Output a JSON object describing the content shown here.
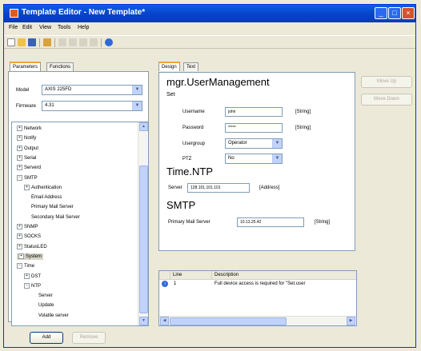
{
  "window": {
    "title": "Template Editor - New Template*"
  },
  "menu": [
    "File",
    "Edit",
    "View",
    "Tools",
    "Help"
  ],
  "left": {
    "tabs": [
      "Parameters",
      "Functions"
    ],
    "model_label": "Model",
    "model_value": "AXIS 225FD",
    "firmware_label": "Firmware",
    "firmware_value": "4.31",
    "tree": [
      {
        "label": "Network",
        "indent": 0,
        "expander": "+"
      },
      {
        "label": "Notify",
        "indent": 0,
        "expander": "+"
      },
      {
        "label": "Output",
        "indent": 0,
        "expander": "+"
      },
      {
        "label": "Serial",
        "indent": 0,
        "expander": "+"
      },
      {
        "label": "Serverd",
        "indent": 0,
        "expander": "+"
      },
      {
        "label": "SMTP",
        "indent": 0,
        "expander": "−"
      },
      {
        "label": "Authentication",
        "indent": 1,
        "expander": "+"
      },
      {
        "label": "Email Address",
        "indent": 2,
        "expander": ""
      },
      {
        "label": "Primary Mail Server",
        "indent": 2,
        "expander": ""
      },
      {
        "label": "Secondary Mail Server",
        "indent": 2,
        "expander": ""
      },
      {
        "label": "SNMP",
        "indent": 0,
        "expander": "+"
      },
      {
        "label": "SOCKS",
        "indent": 0,
        "expander": "+"
      },
      {
        "label": "StatusLED",
        "indent": 0,
        "expander": "+"
      },
      {
        "label": "System",
        "indent": 0,
        "expander": "+",
        "selected": true
      },
      {
        "label": "Time",
        "indent": 0,
        "expander": "−"
      },
      {
        "label": "DST",
        "indent": 1,
        "expander": "+"
      },
      {
        "label": "NTP",
        "indent": 1,
        "expander": "−"
      },
      {
        "label": "Server",
        "indent": 3,
        "expander": ""
      },
      {
        "label": "Update",
        "indent": 3,
        "expander": ""
      },
      {
        "label": "Volatile server",
        "indent": 3,
        "expander": ""
      }
    ],
    "add_button": "Add",
    "remove_button": "Remove"
  },
  "right": {
    "tabs": [
      "Design",
      "Text"
    ],
    "move_up": "Move Up",
    "move_down": "Move Down",
    "section1": {
      "heading": "mgr.UserManagement",
      "sub": "Set",
      "username_label": "Username",
      "username_value": "john",
      "username_type": "[String]",
      "password_label": "Password",
      "password_value": "*****",
      "password_type": "[String]",
      "usergroup_label": "Usergroup",
      "usergroup_value": "Operator",
      "ptz_label": "PTZ",
      "ptz_value": "No"
    },
    "section2": {
      "heading": "Time.NTP",
      "server_label": "Server",
      "server_value": "128.101.101.101",
      "server_type": "[Address]"
    },
    "section3": {
      "heading": "SMTP",
      "pms_label": "Primary Mail Server",
      "pms_value": "10.13.25.42",
      "pms_type": "[String]"
    },
    "grid": {
      "headers": [
        "Line",
        "Description"
      ],
      "rows": [
        {
          "line": "1",
          "description": "Full device access is required for \"Set.user"
        }
      ]
    }
  },
  "colors": {
    "titlebar": "#0842c9",
    "accent": "#f1a533",
    "selection": "#d8d5c6"
  }
}
